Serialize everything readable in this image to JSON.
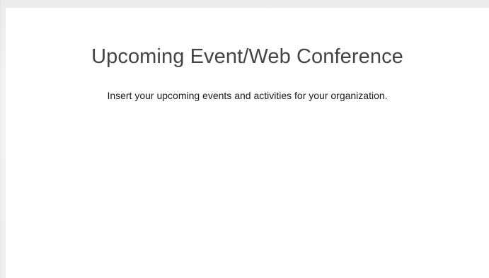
{
  "section": {
    "title": "Upcoming Event/Web Conference",
    "description": "Insert your upcoming events and activities for your organization."
  },
  "colors": {
    "page_background": "#f1f1f1",
    "panel_background": "#ffffff",
    "title_text": "#444444",
    "body_text": "#1a1a1a"
  }
}
